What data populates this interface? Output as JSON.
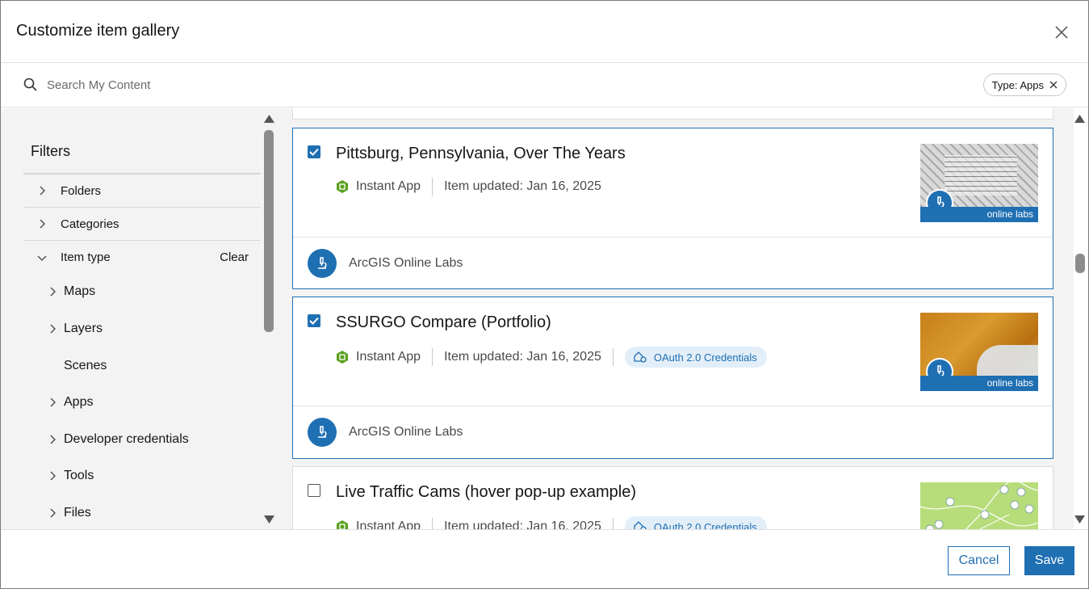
{
  "dialog": {
    "title": "Customize item gallery"
  },
  "search": {
    "placeholder": "Search My Content",
    "chip_label": "Type: Apps"
  },
  "filters": {
    "title": "Filters",
    "sections": [
      {
        "label": "Folders",
        "expanded": false
      },
      {
        "label": "Categories",
        "expanded": false
      },
      {
        "label": "Item type",
        "expanded": true,
        "clear_label": "Clear"
      }
    ],
    "item_types": [
      {
        "label": "Maps",
        "has_children": true
      },
      {
        "label": "Layers",
        "has_children": true
      },
      {
        "label": "Scenes",
        "has_children": false
      },
      {
        "label": "Apps",
        "has_children": true,
        "active": true
      },
      {
        "label": "Developer credentials",
        "has_children": true
      },
      {
        "label": "Tools",
        "has_children": true
      },
      {
        "label": "Files",
        "has_children": true
      }
    ]
  },
  "items": [
    {
      "title": "Pittsburg, Pennsylvania, Over The Years",
      "selected": true,
      "type": "Instant App",
      "updated": "Item updated: Jan 16, 2025",
      "badge": "",
      "owner": "ArcGIS Online Labs",
      "thumb_banner": "online labs",
      "thumb_style": "map-old"
    },
    {
      "title": "SSURGO Compare (Portfolio)",
      "selected": true,
      "type": "Instant App",
      "updated": "Item updated: Jan 16, 2025",
      "badge": "OAuth 2.0 Credentials",
      "owner": "ArcGIS Online Labs",
      "thumb_banner": "online labs",
      "thumb_style": "terrain"
    },
    {
      "title": "Live Traffic Cams (hover pop-up example)",
      "selected": false,
      "type": "Instant App",
      "updated": "Item updated: Jan 16, 2025",
      "badge": "OAuth 2.0 Credentials",
      "owner": "",
      "thumb_banner": "",
      "thumb_style": "traffic"
    }
  ],
  "actions": {
    "cancel_label": "Cancel",
    "save_label": "Save"
  },
  "colors": {
    "accent": "#1f6fb3",
    "instant_app_icon": "#5aa11e",
    "panel_bg": "#f3f3f3"
  },
  "icons": {
    "close": "close-icon",
    "search": "search-icon",
    "chip_remove": "close-icon",
    "chevron_right": "chevron-right-icon",
    "chevron_down": "chevron-down-icon",
    "instant_app": "instant-app-icon",
    "credentials": "oauth-credentials-icon",
    "labs": "microscope-icon"
  }
}
